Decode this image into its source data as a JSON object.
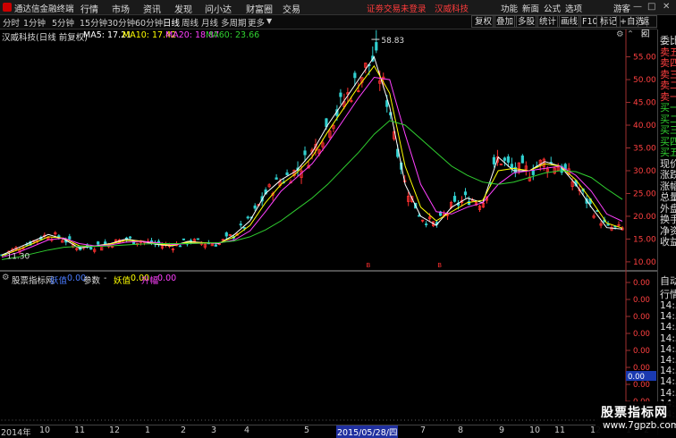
{
  "titlebar": {
    "app_title": "通达信金融终端",
    "menus": [
      "行情",
      "市场",
      "资讯",
      "发现",
      "问小达",
      "财富圈",
      "交易"
    ],
    "notice": "证劵交易未登录",
    "stock_name": "汉威科技",
    "right_menus": [
      "功能",
      "新面",
      "公式",
      "选项"
    ],
    "user": "游客",
    "window_buttons": [
      "—",
      "□",
      "✕"
    ]
  },
  "toolbar": {
    "periods": [
      "分时",
      "1分钟",
      "5分钟",
      "15分钟",
      "30分钟",
      "60分钟",
      "日线",
      "周线",
      "月线",
      "多周期",
      "更多"
    ],
    "active_period": "日线",
    "right_tools": [
      "复权",
      "叠加",
      "多股",
      "统计",
      "画线",
      "F10",
      "标记",
      "+自选",
      "返回"
    ]
  },
  "main_chart": {
    "title": "汉威科技(日线 前复权)",
    "ma5": "MA5: 17.21",
    "ma10": "MA10: 17.42",
    "ma20": "MA20: 18.87",
    "ma60": "MA60: 23.66",
    "colors": {
      "ma5": "#ffffff",
      "ma10": "#ffff00",
      "ma20": "#ff40ff",
      "ma60": "#30d030",
      "up": "#ff3030",
      "down": "#30d0d0"
    },
    "high_label": "58.83",
    "low_label": "11.30",
    "marker_labels": [
      "B",
      "B"
    ]
  },
  "indicator": {
    "name": "股票指标网",
    "fields": [
      {
        "label": "妖值",
        "value": "0.00"
      },
      {
        "label": "参数",
        "value": "-"
      },
      {
        "label": "妖值",
        "value": "0.00"
      },
      {
        "label": "升幅",
        "value": "0.00"
      }
    ],
    "ticks": [
      "0.00",
      "0.00",
      "0.00",
      "0.00",
      "0.00",
      "0.00",
      "0.00",
      "0.00"
    ],
    "cursor_value": "0.00"
  },
  "right_panel": {
    "labels": [
      "委比",
      "卖五",
      "卖四",
      "卖三",
      "卖二",
      "卖一",
      "买一",
      "买二",
      "买三",
      "买四",
      "买五",
      "现价",
      "涨跌",
      "涨幅",
      "总量",
      "外盘",
      "换手",
      "净资",
      "收益"
    ],
    "lower_labels": [
      "自动",
      "行情"
    ],
    "times": [
      "14:5",
      "14:5",
      "14:5",
      "14:5",
      "14:5",
      "14:5",
      "14:5",
      "14:5",
      "14:5",
      "14:5",
      "14:5",
      "14:5"
    ]
  },
  "date_axis": {
    "labels": [
      "2014年",
      "10",
      "11",
      "12",
      "1",
      "2",
      "3",
      "4",
      "5",
      "2015/05/28/四",
      "7",
      "8",
      "9",
      "10",
      "11",
      "12",
      "1",
      "2"
    ],
    "highlighted": "2015/05/28/四"
  },
  "watermark": {
    "title": "股票指标网",
    "url": "www.7gpzb.com"
  },
  "chart_data": {
    "type": "line",
    "title": "汉威科技(日线 前复权)",
    "y_axis_ticks": [
      55.0,
      50.0,
      45.0,
      40.0,
      35.0,
      30.0,
      25.0,
      20.0,
      15.0,
      10.0
    ],
    "ylim": [
      9,
      61
    ],
    "x_labels": [
      "2014年",
      "10",
      "11",
      "12",
      "1",
      "2",
      "3",
      "4",
      "5",
      "2015/05/28/四",
      "7",
      "8",
      "9",
      "10",
      "11",
      "12",
      "1",
      "2"
    ],
    "annotations": {
      "high": 58.83,
      "low": 11.3
    },
    "series": [
      {
        "name": "MA5",
        "values": [
          11.5,
          13,
          14.5,
          16,
          15,
          13,
          13.5,
          14,
          15,
          14.5,
          13.8,
          13.5,
          14.5,
          14.2,
          14,
          16,
          19,
          25,
          28,
          30,
          34,
          40,
          45,
          50,
          55,
          44,
          27,
          20,
          18,
          22,
          24,
          23,
          33,
          30,
          30,
          32,
          31,
          27,
          22,
          17.5,
          17.2
        ]
      },
      {
        "name": "MA10",
        "values": [
          11.3,
          12.6,
          14,
          15.5,
          15.2,
          13.5,
          13.4,
          13.9,
          14.7,
          14.6,
          14,
          13.6,
          14.3,
          14.2,
          14.1,
          15.5,
          18,
          23,
          27,
          29.5,
          33,
          38.5,
          43.5,
          48.5,
          53,
          47,
          31,
          22,
          19,
          21,
          23,
          23.5,
          30,
          30.5,
          30,
          31.5,
          31,
          28,
          23.5,
          18.5,
          17.4
        ]
      },
      {
        "name": "MA20",
        "values": [
          11,
          12,
          13.4,
          14.8,
          15.2,
          14,
          13.5,
          13.7,
          14.3,
          14.5,
          14.2,
          13.8,
          14,
          14.1,
          14.1,
          14.8,
          16.8,
          21,
          25.5,
          28.5,
          31.5,
          36,
          41,
          46,
          50.5,
          50,
          38,
          27,
          21,
          20.5,
          22,
          23,
          27,
          29.5,
          30,
          30.5,
          31,
          29,
          25.5,
          20.5,
          18.9
        ]
      },
      {
        "name": "MA60",
        "values": [
          10.5,
          11,
          11.8,
          12.6,
          13.2,
          13.4,
          13.4,
          13.5,
          13.7,
          13.9,
          14,
          14,
          14,
          14.1,
          14.2,
          14.6,
          15.5,
          17,
          19,
          21.5,
          24,
          27,
          30.5,
          34,
          38,
          41,
          40,
          37,
          34,
          31,
          29,
          27.5,
          27,
          27.5,
          28.5,
          29.5,
          30,
          29.8,
          28.5,
          26,
          23.7
        ]
      }
    ]
  }
}
